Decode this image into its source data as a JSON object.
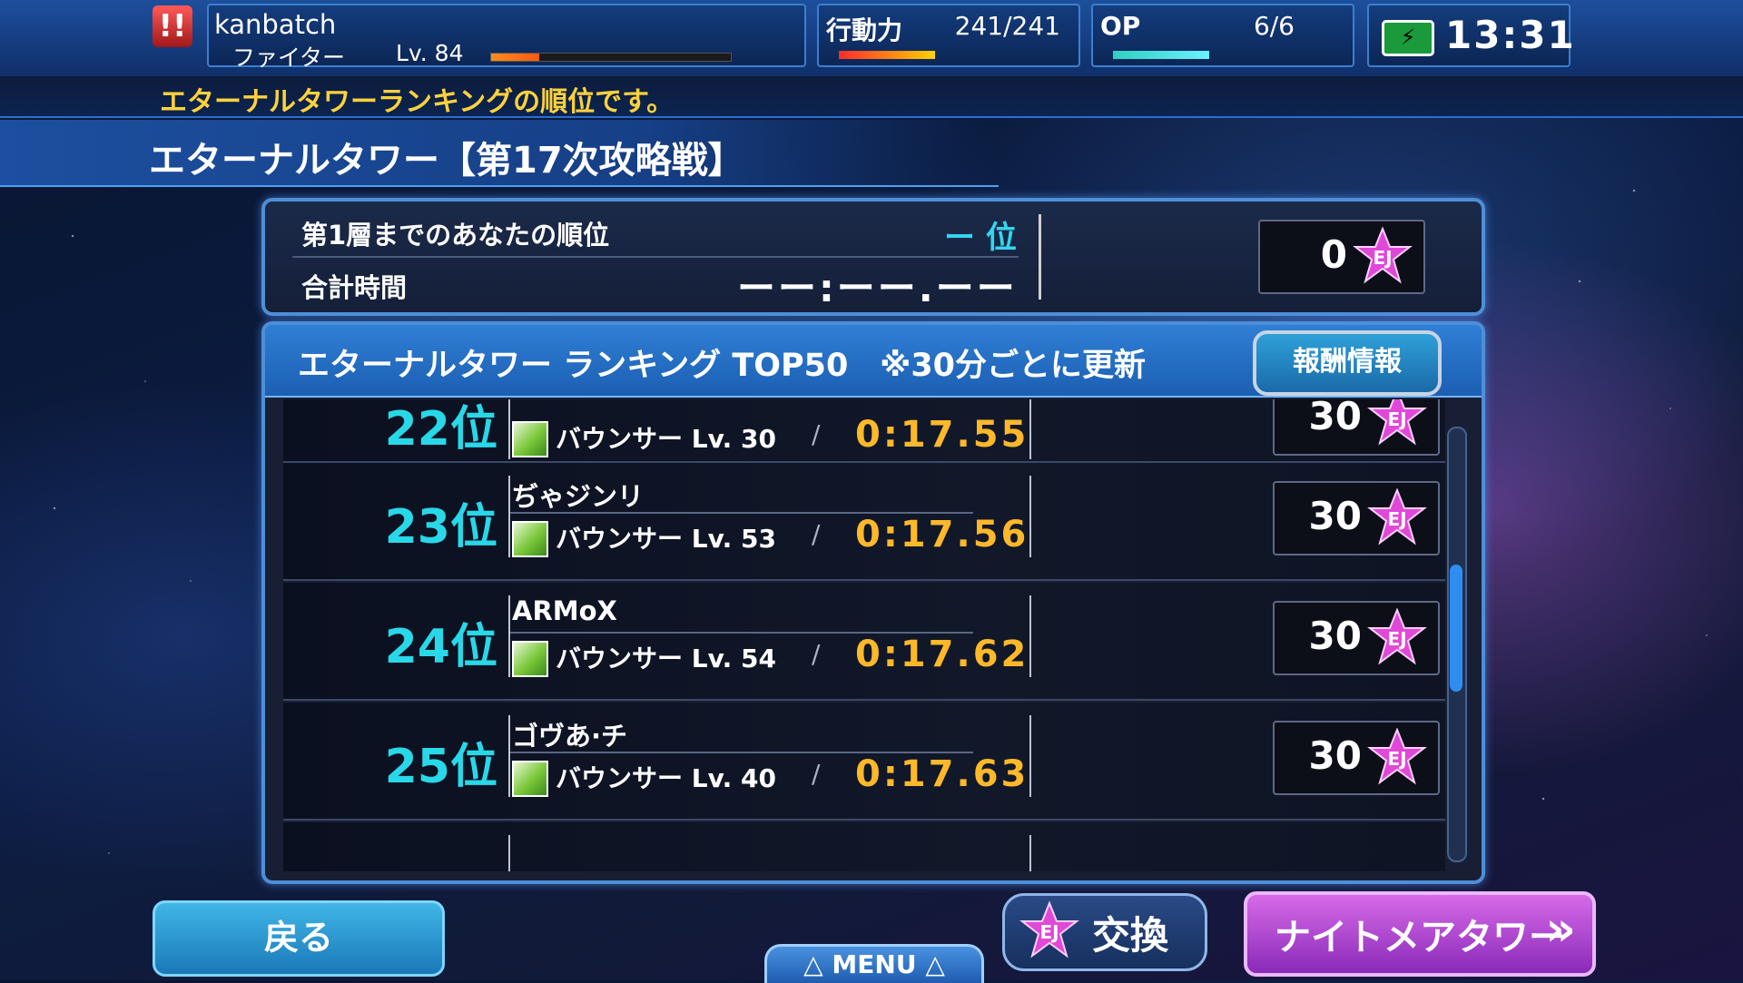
{
  "player": {
    "name": "kanbatch",
    "class": "ファイター",
    "level": "Lv. 84",
    "exp_fraction": 0.2
  },
  "action_power": {
    "label": "行動力",
    "value": "241/241",
    "fraction": 1.0
  },
  "op": {
    "label": "OP",
    "value": "6/6",
    "fraction": 1.0
  },
  "clock": {
    "time": "13:31"
  },
  "ticker": {
    "text": "エターナルタワーランキングの順位です。"
  },
  "screen_title": "エターナルタワー【第17次攻略戦】",
  "my_rank": {
    "rank_label": "第1層までのあなたの順位",
    "rank_value": "ー 位",
    "time_label": "合計時間",
    "time_value": "ーー:ーー.ーー",
    "reward": "0"
  },
  "ranking": {
    "header": "エターナルタワー ランキング TOP50　※30分ごとに更新",
    "reward_info_button": "報酬情報",
    "rows": [
      {
        "rank": "22位",
        "name": "",
        "class": "バウンサー",
        "level": "Lv. 30",
        "time": "0:17.55",
        "reward": "30"
      },
      {
        "rank": "23位",
        "name": "ぢゃジンリ",
        "class": "バウンサー",
        "level": "Lv. 53",
        "time": "0:17.56",
        "reward": "30"
      },
      {
        "rank": "24位",
        "name": "ARMoX",
        "class": "バウンサー",
        "level": "Lv. 54",
        "time": "0:17.62",
        "reward": "30"
      },
      {
        "rank": "25位",
        "name": "ゴヴあ·チ",
        "class": "バウンサー",
        "level": "Lv. 40",
        "time": "0:17.63",
        "reward": "30"
      }
    ]
  },
  "icons": {
    "alert": "alert-icon",
    "battery": "battery-icon",
    "ej_currency": "ej-star-icon",
    "class": "bouncer-class-icon"
  },
  "bottom": {
    "back": "戻る",
    "exchange": "交換",
    "nightmare": "ナイトメアタワー",
    "menu": "△ MENU △"
  },
  "colors": {
    "rank_cyan": "#28d8e8",
    "time_orange": "#ffb82a",
    "ticker_yellow": "#ffd23c",
    "ej_magenta": "#e048d8"
  }
}
